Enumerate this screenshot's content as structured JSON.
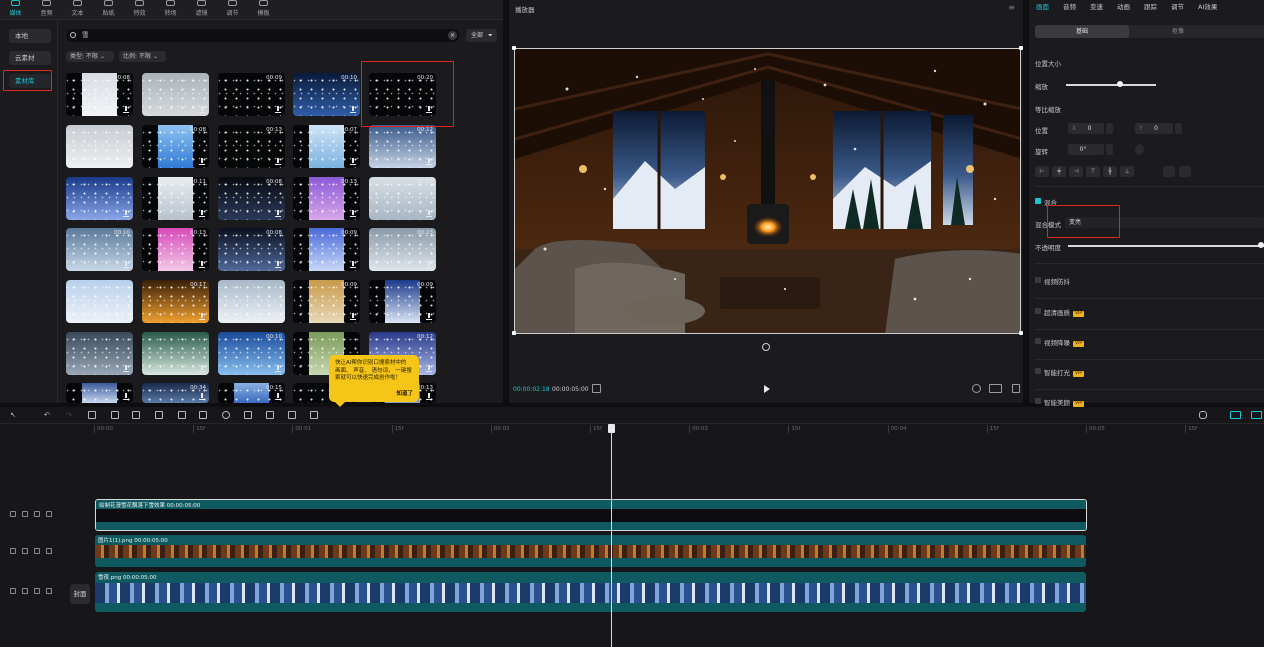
{
  "media": {
    "tools": [
      "媒体",
      "音频",
      "文本",
      "贴纸",
      "特效",
      "转场",
      "滤镜",
      "调节",
      "模板"
    ],
    "active_tool": 0,
    "nav": [
      "本地",
      "云素材",
      "素材库"
    ],
    "active_nav": 2,
    "search": {
      "value": "雪",
      "filter_label": "全部"
    },
    "filters": {
      "type_label": "类型: 不限",
      "ratio_label": "比例: 不限"
    },
    "durations": [
      "00:08",
      "",
      "00:09",
      "00:10",
      "00:20",
      "",
      "00:08",
      "00:13",
      "00:07",
      "00:12",
      "",
      "00:11",
      "00:08",
      "00:13",
      "00:07",
      "00:10",
      "00:13",
      "00:08",
      "00:09",
      "00:23",
      "",
      "00:17",
      "",
      "00:09",
      "00:09",
      "",
      "",
      "00:10",
      "",
      "00:12",
      "",
      "00:34",
      "00:15",
      "",
      "00:13"
    ],
    "tooltip": {
      "text": "快让AI帮你识别口搜索材中的 画面、 声音、 语句词， 一键搜 索就可以快速完成创作啦！",
      "ok": "知道了"
    }
  },
  "player": {
    "title": "播放器",
    "current_time": "00:00:02:18",
    "total_time": "00:00:05:00"
  },
  "props": {
    "tabs": [
      "画面",
      "音频",
      "变速",
      "动画",
      "跟踪",
      "调节",
      "AI效果"
    ],
    "active_tab": 0,
    "sub_tabs": [
      "基础",
      "抠像"
    ],
    "section_position": "位置大小",
    "scale_label": "缩放",
    "uniform_scale_label": "等比缩放",
    "position_label": "位置",
    "x_prefix": "X",
    "x_value": "0",
    "y_prefix": "Y",
    "y_value": "0",
    "rotate_label": "旋转",
    "rotate_value": "0°",
    "blend_label": "混合",
    "blend_mode_label": "混合模式",
    "blend_mode_value": "变亮",
    "opacity_label": "不透明度",
    "scale_level": 0.6,
    "opacity_level": 1.0,
    "features": [
      {
        "label": "视频防抖",
        "vip": false
      },
      {
        "label": "超清画质",
        "vip": true
      },
      {
        "label": "视频降噪",
        "vip": true
      },
      {
        "label": "智能打光",
        "vip": true
      },
      {
        "label": "智能美颜",
        "vip": true
      }
    ],
    "vip_text": "VIP"
  },
  "timeline": {
    "ruler": [
      "00:00",
      "15f",
      "00:01",
      "15f",
      "00:02",
      "15f",
      "00:03",
      "15f",
      "00:04",
      "15f",
      "00:05",
      "15f"
    ],
    "clips": [
      {
        "label": "绘制花漫雪花飘落下雪效果  00:00:05:00"
      },
      {
        "label": "图片1(1).png  00:00:05:00"
      },
      {
        "label": "雪夜.png  00:00:05:00"
      }
    ],
    "cover_label": "封面"
  }
}
